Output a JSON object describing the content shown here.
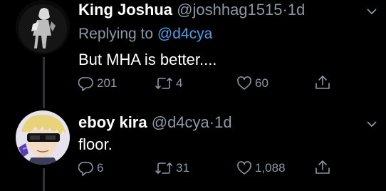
{
  "tweets": [
    {
      "display_name": "King Joshua",
      "handle": "@joshhag1515",
      "separator": "·",
      "time": "1d",
      "replying_prefix": "Replying to",
      "replying_to": "@d4cya",
      "text": "But MHA is better....",
      "replies": "201",
      "retweets": "4",
      "likes": "60"
    },
    {
      "display_name": "eboy kira",
      "handle": "@d4cya",
      "separator": "·",
      "time": "1d",
      "text": "floor.",
      "replies": "6",
      "retweets": "31",
      "likes": "1,088"
    }
  ],
  "colors": {
    "background": "#000000",
    "text": "#ffffff",
    "muted": "#8b98a5",
    "link": "#4f9ee8",
    "thread_line": "#2f3336"
  },
  "icons": [
    "chevron-down-icon",
    "reply-icon",
    "retweet-icon",
    "like-icon",
    "share-icon"
  ]
}
